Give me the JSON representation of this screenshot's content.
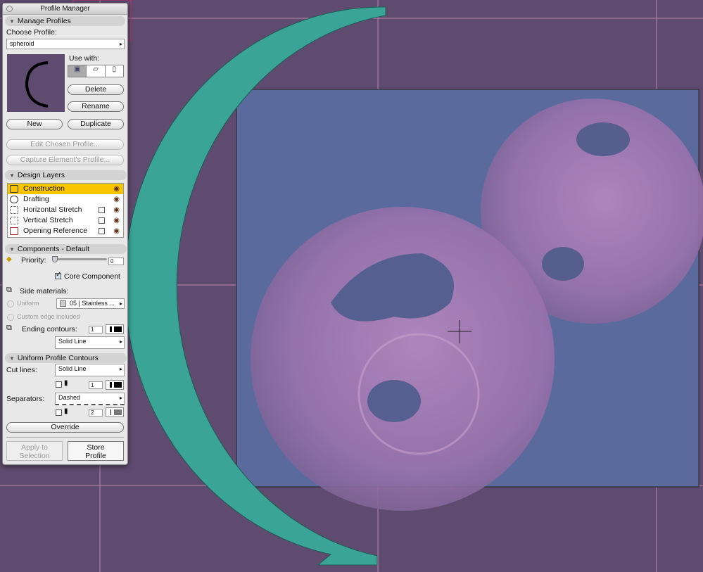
{
  "window": {
    "title": "Profile Manager"
  },
  "manage": {
    "header": "Manage Profiles",
    "choose_label": "Choose Profile:",
    "profile_value": "spheroid",
    "use_with_label": "Use with:",
    "delete": "Delete",
    "rename": "Rename",
    "new": "New",
    "duplicate": "Duplicate",
    "edit": "Edit Chosen Profile...",
    "capture": "Capture Element's Profile..."
  },
  "layers": {
    "header": "Design Layers",
    "items": [
      {
        "label": "Construction"
      },
      {
        "label": "Drafting"
      },
      {
        "label": "Horizontal Stretch"
      },
      {
        "label": "Vertical Stretch"
      },
      {
        "label": "Opening Reference"
      }
    ]
  },
  "components": {
    "header": "Components - Default",
    "priority_label": "Priority:",
    "priority_value": "0",
    "core_label": "Core Component",
    "side_materials": "Side materials:",
    "uniform": "Uniform",
    "material": "05 | Stainless ...",
    "custom_edge": "Custom edge included",
    "ending_contours": "Ending contours:",
    "ending_pen": "1",
    "ending_line": "Solid Line"
  },
  "contours": {
    "header": "Uniform Profile Contours",
    "cut_lines_label": "Cut lines:",
    "cut_line": "Solid Line",
    "cut_pen": "1",
    "separators_label": "Separators:",
    "separator_line": "Dashed",
    "separator_pen": "2",
    "override": "Override",
    "apply": "Apply to Selection",
    "store": "Store Profile"
  },
  "colors": {
    "background": "#5f4b6f",
    "accent": "#f9c400",
    "arc": "#3aa597",
    "box": "#5a6a9c"
  }
}
